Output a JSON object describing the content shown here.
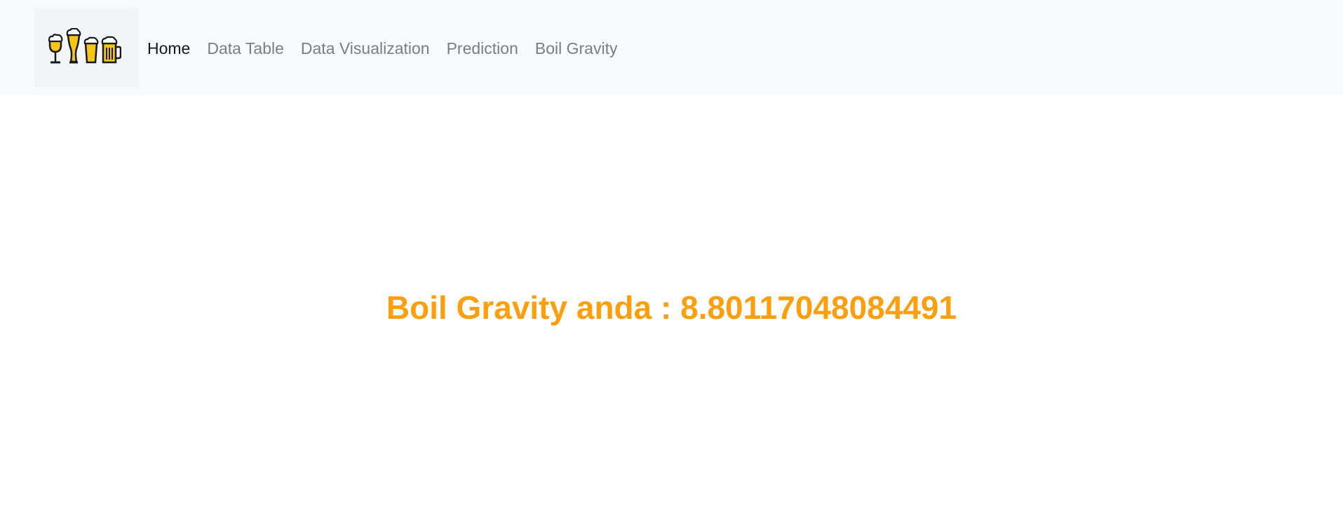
{
  "navbar": {
    "brand_icon": "beer-glasses-icon",
    "links": [
      {
        "label": "Home",
        "active": true
      },
      {
        "label": "Data Table",
        "active": false
      },
      {
        "label": "Data Visualization",
        "active": false
      },
      {
        "label": "Prediction",
        "active": false
      },
      {
        "label": "Boil Gravity",
        "active": false
      }
    ]
  },
  "main": {
    "result_label": "Boil Gravity anda : ",
    "result_value": "8.80117048084491"
  },
  "colors": {
    "accent": "#ff9f0f",
    "navbar_bg": "#f8f9fa",
    "beer": "#f5c518"
  }
}
